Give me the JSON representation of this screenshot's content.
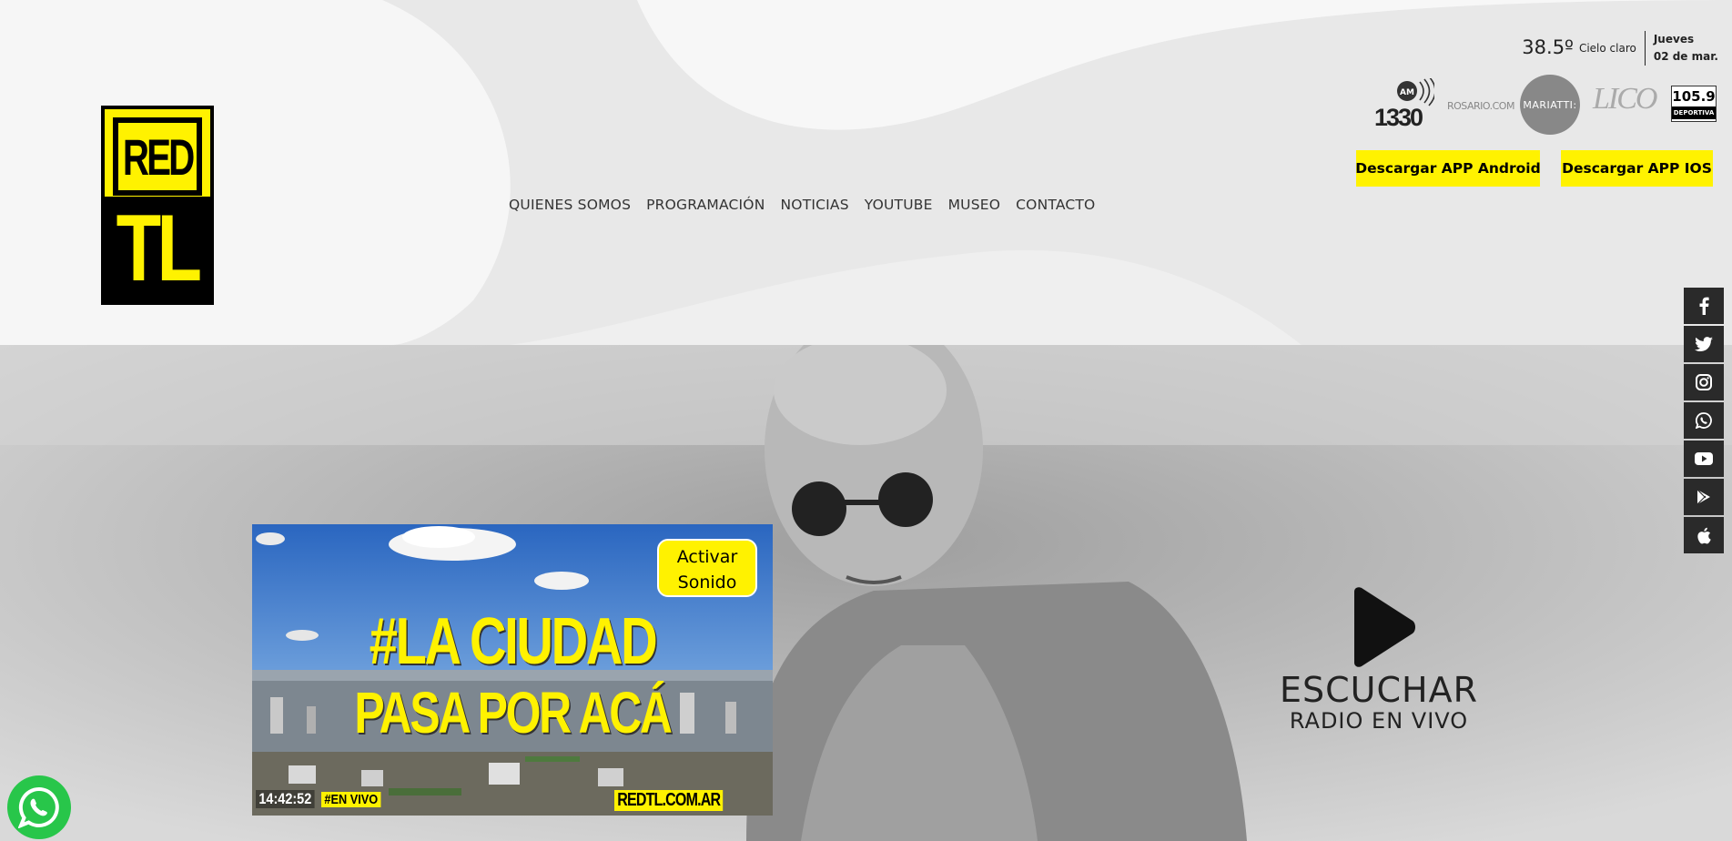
{
  "logo": {
    "line1": "RED",
    "line2": "TL"
  },
  "nav": [
    {
      "label": "QUIENES SOMOS"
    },
    {
      "label": "PROGRAMACIÓN"
    },
    {
      "label": "NOTICIAS"
    },
    {
      "label": "YOUTUBE"
    },
    {
      "label": "MUSEO"
    },
    {
      "label": "CONTACTO"
    }
  ],
  "weather": {
    "temp": "38.5º",
    "desc": "Cielo claro",
    "day": "Jueves",
    "date": "02 de mar."
  },
  "stations": [
    {
      "icon": "am1330-logo",
      "label": "1330",
      "sub": "AM"
    },
    {
      "icon": "rosario-com-logo",
      "label": "ROSARIO.COM"
    },
    {
      "icon": "mariatti-logo",
      "label": "MARIATTI:"
    },
    {
      "icon": "lico-logo",
      "label": "LICO"
    },
    {
      "icon": "deportiva-logo",
      "label": "105.9",
      "sub": "DEPORTIVA"
    }
  ],
  "apps": {
    "android": "Descargar APP Android",
    "ios": "Descargar APP IOS"
  },
  "social": [
    "facebook-icon",
    "twitter-icon",
    "instagram-icon",
    "whatsapp-icon",
    "youtube-icon",
    "google-play-icon",
    "apple-icon"
  ],
  "video": {
    "headline1": "#LA CIUDAD",
    "headline2": "PASA POR ACÁ",
    "sound_button": "Activar Sonido",
    "time": "14:42:52",
    "live": "#EN VIVO",
    "watermark": "REDTL.COM.AR"
  },
  "radio": {
    "line1": "ESCUCHAR",
    "line2": "RADIO EN VIVO"
  },
  "colors": {
    "accent": "#fff200",
    "dark": "#2a2a2a",
    "whatsapp": "#28c64a"
  }
}
